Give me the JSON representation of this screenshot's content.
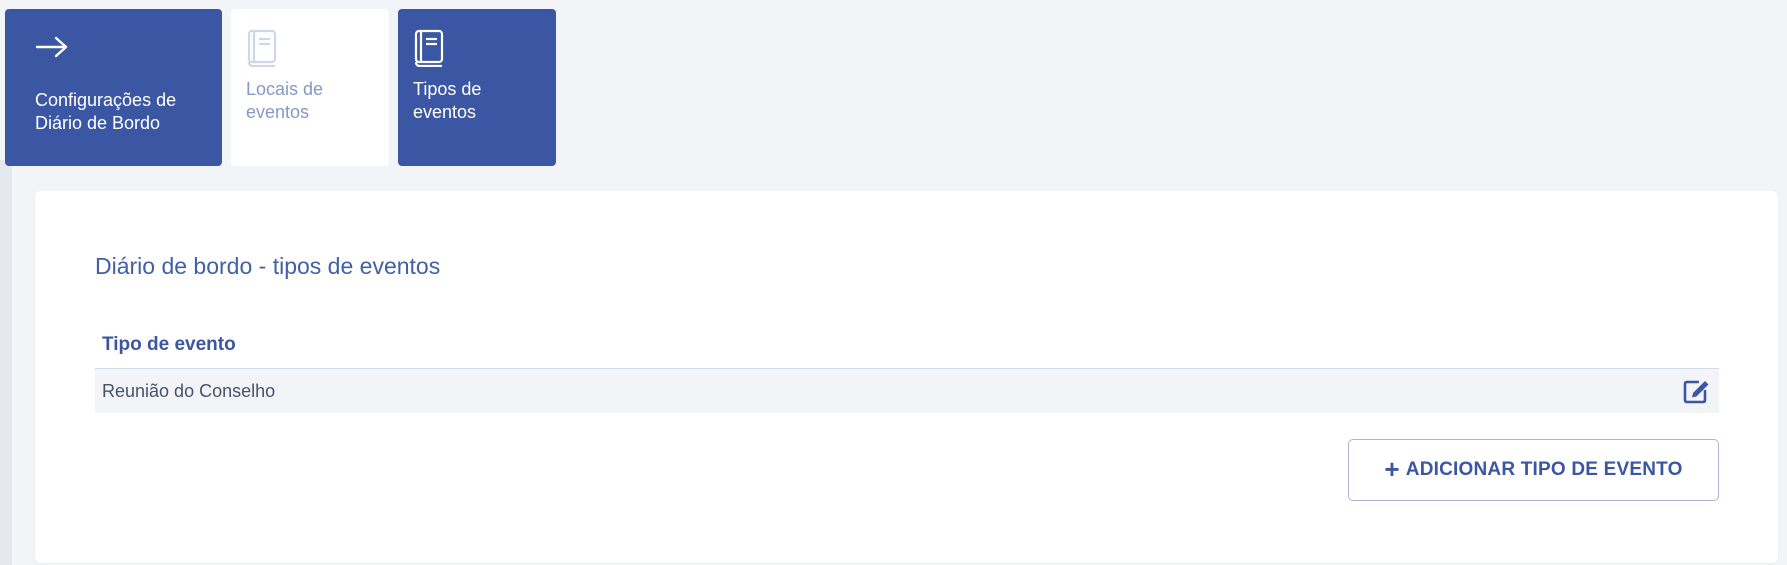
{
  "nav_tiles": [
    {
      "label": "Configurações de\nDiário de Bordo",
      "icon": "arrow-right-icon",
      "active": true
    },
    {
      "label": "Locais de\neventos",
      "icon": "book-icon",
      "active": false
    },
    {
      "label": "Tipos de\neventos",
      "icon": "book-icon",
      "active": true
    }
  ],
  "panel": {
    "title": "Diário de bordo - tipos de eventos",
    "table": {
      "header": "Tipo de evento",
      "rows": [
        {
          "name": "Reunião do Conselho",
          "action_icon": "edit-icon"
        }
      ]
    },
    "add_button": {
      "icon": "plus-icon",
      "label": "ADICIONAR TIPO DE EVENTO"
    }
  },
  "colors": {
    "primary": "#3b57a3",
    "background": "#f3f4f8",
    "tile_light_text": "#8797c6"
  }
}
